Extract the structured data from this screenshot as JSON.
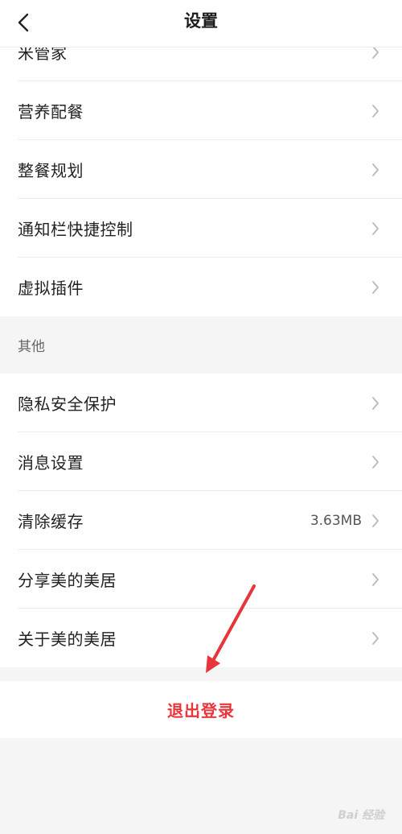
{
  "header": {
    "title": "设置",
    "back_icon": "chevron-left-icon"
  },
  "top_group": {
    "items": [
      {
        "label": "米管家"
      },
      {
        "label": "营养配餐"
      },
      {
        "label": "整餐规划"
      },
      {
        "label": "通知栏快捷控制"
      },
      {
        "label": "虚拟插件"
      }
    ]
  },
  "other_section": {
    "title": "其他",
    "items": [
      {
        "label": "隐私安全保护"
      },
      {
        "label": "消息设置"
      },
      {
        "label": "清除缓存",
        "value": "3.63MB"
      },
      {
        "label": "分享美的美居"
      },
      {
        "label": "关于美的美居"
      }
    ]
  },
  "logout": {
    "label": "退出登录"
  },
  "annotation": {
    "type": "arrow",
    "color": "#e8353b"
  },
  "watermark": {
    "text": "Bai 经验"
  },
  "colors": {
    "accent": "#e8353b",
    "chevron": "#b9b9b9",
    "background": "#f5f5f5"
  }
}
